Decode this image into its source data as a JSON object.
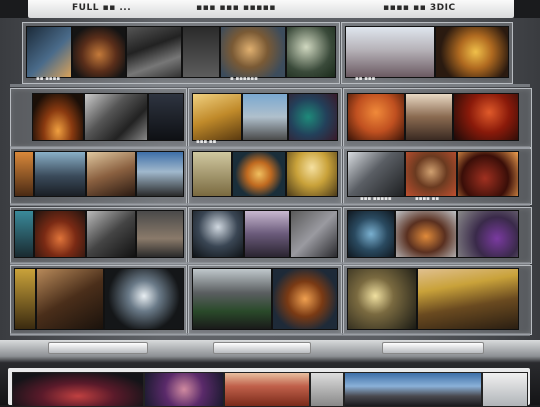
{
  "header": {
    "left_text": "FULL ▪▪ ...",
    "middle_text": "▪▪▪ ▪▪▪ ▪▪▪▪▪",
    "right_text": "▪▪▪▪ ▪▪ 3DIC"
  },
  "gallery": {
    "captions": [
      "▪▪ ▪▪▪▪",
      "▪ ▪▪▪▪▪▪",
      "▪▪ ▪▪▪",
      "▪▪▪ ▪▪",
      "▪▪▪ ▪▪▪▪▪",
      "▪▪▪▪ ▪▪"
    ]
  },
  "colors": {
    "wall": "#5b5e63",
    "frame": "#b8bcc1",
    "shelf": "#8f9398",
    "strip": "#e9eaeb",
    "warm_accent": "#d2691e",
    "gold_accent": "#c9a23a",
    "sky_blue": "#3d6fa8"
  }
}
